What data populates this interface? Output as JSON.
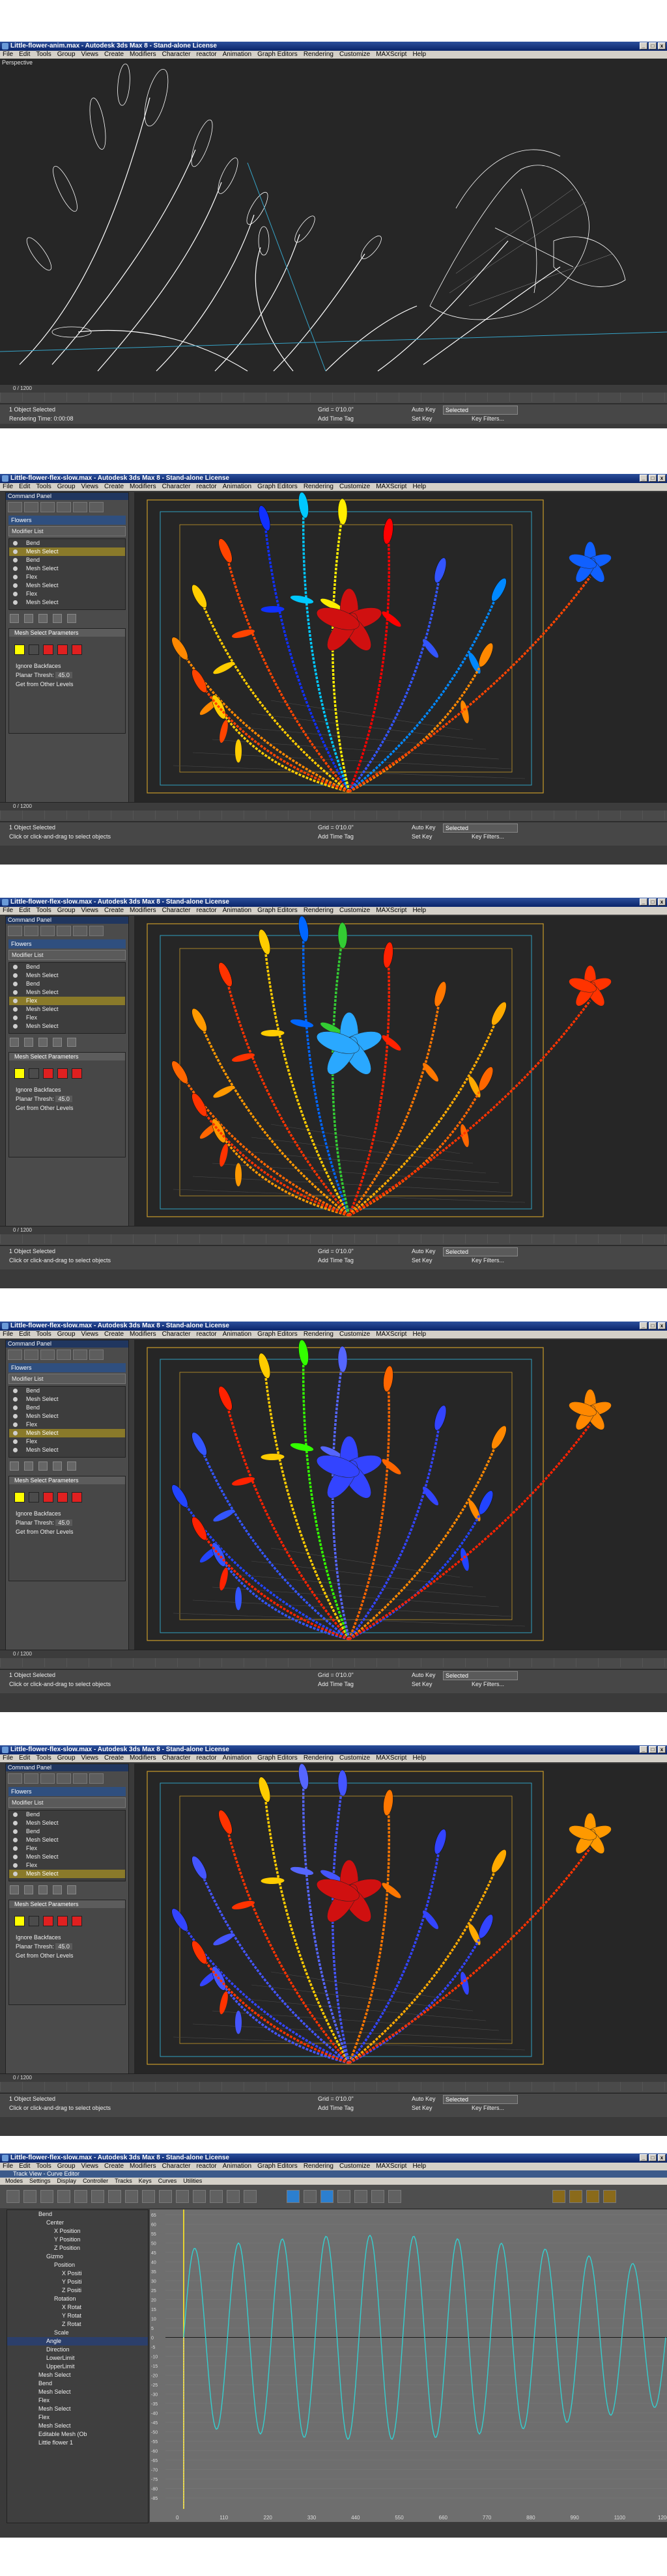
{
  "menu_items": [
    "File",
    "Edit",
    "Tools",
    "Group",
    "Views",
    "Create",
    "Modifiers",
    "Character",
    "reactor",
    "Animation",
    "Graph Editors",
    "Rendering",
    "Customize",
    "MAXScript",
    "Help"
  ],
  "shot1": {
    "title": "Little-flower-anim.max - Autodesk 3ds Max 8 - Stand-alone License",
    "viewport_label": "Perspective",
    "time_slider": "0 / 1200",
    "status_line1": "1 Object Selected",
    "status_line2": "Rendering Time: 0:00:08",
    "grid": "Grid = 0'10.0\"",
    "add_time_tag": "Add Time Tag",
    "auto_key": "Auto Key",
    "set_key": "Set Key",
    "selected": "Selected",
    "key_filters": "Key Filters...",
    "frame": "0"
  },
  "shot_common": {
    "title": "Little-flower-flex-slow.max - Autodesk 3ds Max 8 - Stand-alone License",
    "cmd_panel_header": "Command Panel",
    "object_name": "Flowers",
    "modifier_list": "Modifier List",
    "rollout_title": "Mesh Select Parameters",
    "ignore_backfaces": "Ignore Backfaces",
    "planar_thresh": "Planar Thresh:",
    "planar_value": "45.0",
    "get_from_other": "Get from Other Levels",
    "time_slider": "0 / 1200",
    "status_line1": "1 Object Selected",
    "status_line2": "Click or click-and-drag to select objects",
    "grid": "Grid = 0'10.0\"",
    "add_time_tag": "Add Time Tag",
    "auto_key": "Auto Key",
    "set_key": "Set Key",
    "selected": "Selected",
    "key_filters": "Key Filters...",
    "frame": "0"
  },
  "shot2_title": "Little-flower-flex-slow.max - Autodesk 3ds Max 8 - Stand-alone License",
  "stacks": [
    [
      "Bend",
      "Mesh Select",
      "Bend",
      "Mesh Select",
      "Flex",
      "Mesh Select",
      "Flex",
      "Mesh Select"
    ],
    [
      "Bend",
      "Mesh Select",
      "Bend",
      "Mesh Select",
      "Flex",
      "Mesh Select",
      "Flex",
      "Mesh Select"
    ],
    [
      "Bend",
      "Mesh Select",
      "Bend",
      "Mesh Select",
      "Flex",
      "Mesh Select",
      "Flex",
      "Mesh Select"
    ],
    [
      "Bend",
      "Mesh Select",
      "Bend",
      "Mesh Select",
      "Flex",
      "Mesh Select",
      "Flex",
      "Mesh Select"
    ]
  ],
  "stack_selected": [
    1,
    4,
    5,
    7
  ],
  "trackview": {
    "title": "Little-flower-flex-slow.max - Autodesk 3ds Max 8 - Stand-alone License",
    "panel_title": "Track View - Curve Editor",
    "menu": [
      "Modes",
      "Settings",
      "Display",
      "Controller",
      "Tracks",
      "Keys",
      "Curves",
      "Utilities"
    ],
    "tree": [
      "Bend",
      "Center",
      "X Position",
      "Y Position",
      "Z Position",
      "Gizmo",
      "Position",
      "X Positi",
      "Y Positi",
      "Z Positi",
      "Rotation",
      "X Rotat",
      "Y Rotat",
      "Z Rotat",
      "Scale",
      "Angle",
      "Direction",
      "LowerLimit",
      "UpperLimit",
      "Mesh Select",
      "Bend",
      "Mesh Select",
      "Flex",
      "Mesh Select",
      "Flex",
      "Mesh Select",
      "Editable Mesh (Ob",
      "Little flower 1"
    ],
    "tree_highlight": 15,
    "y_ticks": [
      "65",
      "60",
      "55",
      "50",
      "45",
      "40",
      "35",
      "30",
      "25",
      "20",
      "15",
      "10",
      "5",
      "0",
      "-5",
      "-10",
      "-15",
      "-20",
      "-25",
      "-30",
      "-35",
      "-40",
      "-45",
      "-50",
      "-55",
      "-60",
      "-65",
      "-70",
      "-75",
      "-80",
      "-85"
    ],
    "x_ticks": [
      "0",
      "110",
      "220",
      "330",
      "440",
      "550",
      "660",
      "770",
      "880",
      "990",
      "1100",
      "1200"
    ]
  },
  "colors": {
    "viewport_bg": "#262626",
    "wire": "#ffffff",
    "selection_yellow": "#ffff00",
    "curve_cyan": "#34d0d0"
  }
}
